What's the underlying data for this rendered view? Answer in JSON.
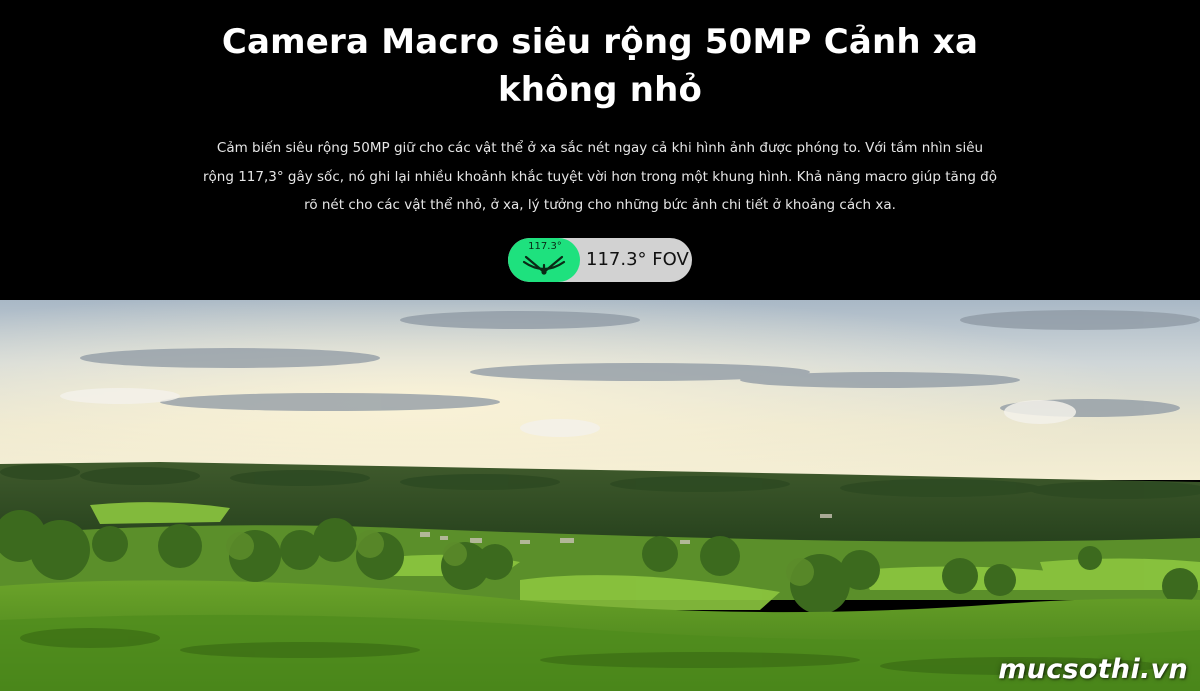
{
  "header": {
    "title": "Camera Macro siêu rộng 50MP Cảnh xa không nhỏ",
    "description": "Cảm biến siêu rộng 50MP giữ cho các vật thể ở xa sắc nét ngay cả khi hình ảnh được phóng to. Với tầm nhìn siêu rộng 117,3° gây sốc, nó ghi lại nhiều khoảnh khắc tuyệt vời hơn trong một khung hình. Khả năng macro giúp tăng độ rõ nét cho các vật thể nhỏ, ở xa, lý tưởng cho những bức ảnh chi tiết ở khoảng cách xa."
  },
  "fov_badge": {
    "icon_label": "117.3°",
    "text": "117.3° FOV",
    "icon": "field-of-view-icon",
    "accent_color": "#1ee17e",
    "pill_color": "#d2d2d2"
  },
  "photo": {
    "subject": "landscape-photo"
  },
  "watermark": {
    "text": "mucsothi.vn"
  }
}
